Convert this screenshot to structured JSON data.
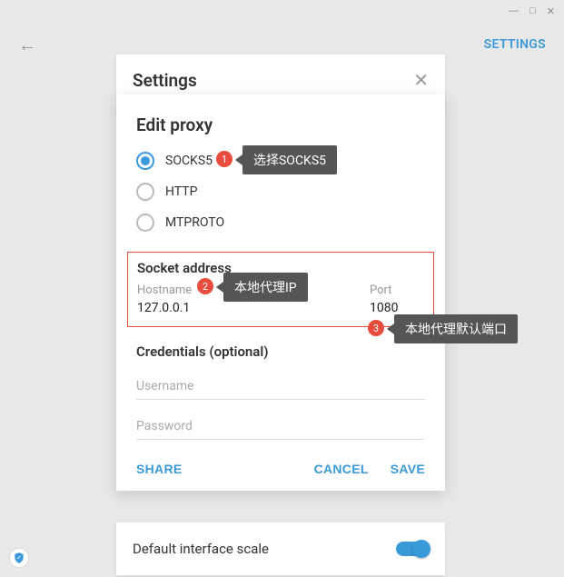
{
  "window": {
    "minimize": "—",
    "maximize": "□",
    "close": "✕"
  },
  "appBar": {
    "back": "←",
    "settingsLink": "SETTINGS"
  },
  "settingsPanel": {
    "title": "Settings",
    "close": "✕"
  },
  "modal": {
    "title": "Edit proxy",
    "radios": {
      "socks5": "SOCKS5",
      "http": "HTTP",
      "mtproto": "MTPROTO"
    },
    "socket": {
      "title": "Socket address",
      "hostnameLabel": "Hostname",
      "hostnameValue": "127.0.0.1",
      "portLabel": "Port",
      "portValue": "1080"
    },
    "credentials": {
      "title": "Credentials (optional)",
      "usernamePlaceholder": "Username",
      "passwordPlaceholder": "Password"
    },
    "actions": {
      "share": "SHARE",
      "cancel": "CANCEL",
      "save": "SAVE"
    }
  },
  "callouts": {
    "c1": {
      "num": "1",
      "text": "选择SOCKS5"
    },
    "c2": {
      "num": "2",
      "text": "本地代理IP"
    },
    "c3": {
      "num": "3",
      "text": "本地代理默认端口"
    }
  },
  "bottom": {
    "label": "Default interface scale"
  }
}
